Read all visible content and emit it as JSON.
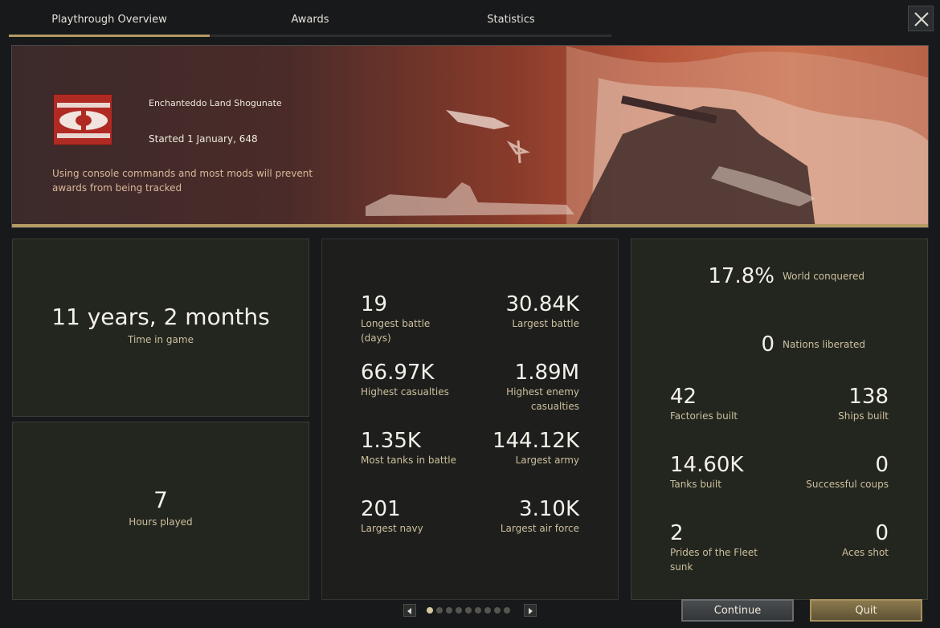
{
  "tabs": [
    {
      "label": "Playthrough Overview",
      "active": true
    },
    {
      "label": "Awards",
      "active": false
    },
    {
      "label": "Statistics",
      "active": false
    }
  ],
  "banner": {
    "nation": "Enchanteddo Land Shogunate",
    "started": "Started 1 January, 648",
    "warning": "Using console commands and most mods will prevent awards from being tracked"
  },
  "time_panel": {
    "value": "11 years, 2 months",
    "label": "Time in game"
  },
  "hours_panel": {
    "value": "7",
    "label": "Hours played"
  },
  "battle_stats": [
    {
      "value": "19",
      "label": "Longest battle (days)"
    },
    {
      "value": "30.84K",
      "label": "Largest battle"
    },
    {
      "value": "66.97K",
      "label": "Highest casualties"
    },
    {
      "value": "1.89M",
      "label": "Highest enemy casualties"
    },
    {
      "value": "1.35K",
      "label": "Most tanks in battle"
    },
    {
      "value": "144.12K",
      "label": "Largest army"
    },
    {
      "value": "201",
      "label": "Largest navy"
    },
    {
      "value": "3.10K",
      "label": "Largest air force"
    }
  ],
  "world": {
    "conquered_value": "17.8%",
    "conquered_label": "World conquered",
    "liberated_value": "0",
    "liberated_label": "Nations liberated"
  },
  "build_stats": [
    {
      "value": "42",
      "label": "Factories built"
    },
    {
      "value": "138",
      "label": "Ships built"
    },
    {
      "value": "14.60K",
      "label": "Tanks built"
    },
    {
      "value": "0",
      "label": "Successful coups"
    },
    {
      "value": "2",
      "label": "Prides of the Fleet sunk"
    },
    {
      "value": "0",
      "label": "Aces shot"
    }
  ],
  "pager": {
    "pages": 9,
    "current": 1
  },
  "buttons": {
    "continue": "Continue",
    "quit": "Quit"
  },
  "colors": {
    "accent_gold": "#b59a63",
    "label_tan": "#cdbf9e",
    "flag_red": "#b02a24"
  },
  "icons": {
    "close": "close-icon",
    "prev": "arrow-left-icon",
    "next": "arrow-right-icon"
  }
}
